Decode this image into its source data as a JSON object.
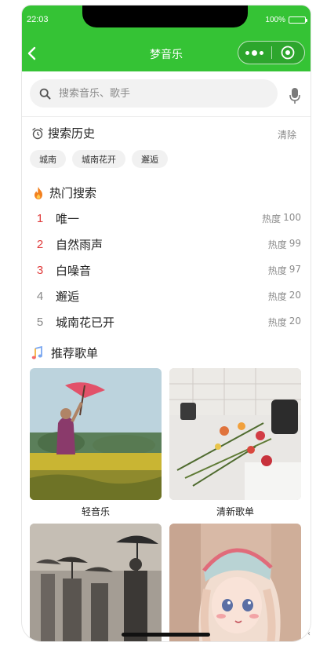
{
  "status_bar": {
    "time": "22:03",
    "battery": "100%"
  },
  "nav": {
    "title": "梦音乐"
  },
  "search": {
    "placeholder": "搜索音乐、歌手"
  },
  "history": {
    "title": "搜索历史",
    "clear_label": "清除",
    "tags": [
      "城南",
      "城南花开",
      "邂逅"
    ]
  },
  "hot": {
    "title": "热门搜索",
    "items": [
      {
        "rank": "1",
        "name": "唯一",
        "heat_label": "热度",
        "heat": "100"
      },
      {
        "rank": "2",
        "name": "自然雨声",
        "heat_label": "热度",
        "heat": "99"
      },
      {
        "rank": "3",
        "name": "白噪音",
        "heat_label": "热度",
        "heat": "97"
      },
      {
        "rank": "4",
        "name": "邂逅",
        "heat_label": "热度",
        "heat": "20"
      },
      {
        "rank": "5",
        "name": "城南花已开",
        "heat_label": "热度",
        "heat": "20"
      }
    ]
  },
  "playlists": {
    "title": "推荐歌单",
    "items": [
      {
        "name": "轻音乐"
      },
      {
        "name": "清新歌单"
      },
      {
        "name": ""
      },
      {
        "name": ""
      }
    ]
  },
  "colors": {
    "brand": "#35c335",
    "rank_top": "#e03b3b",
    "rank_other": "#888888"
  }
}
